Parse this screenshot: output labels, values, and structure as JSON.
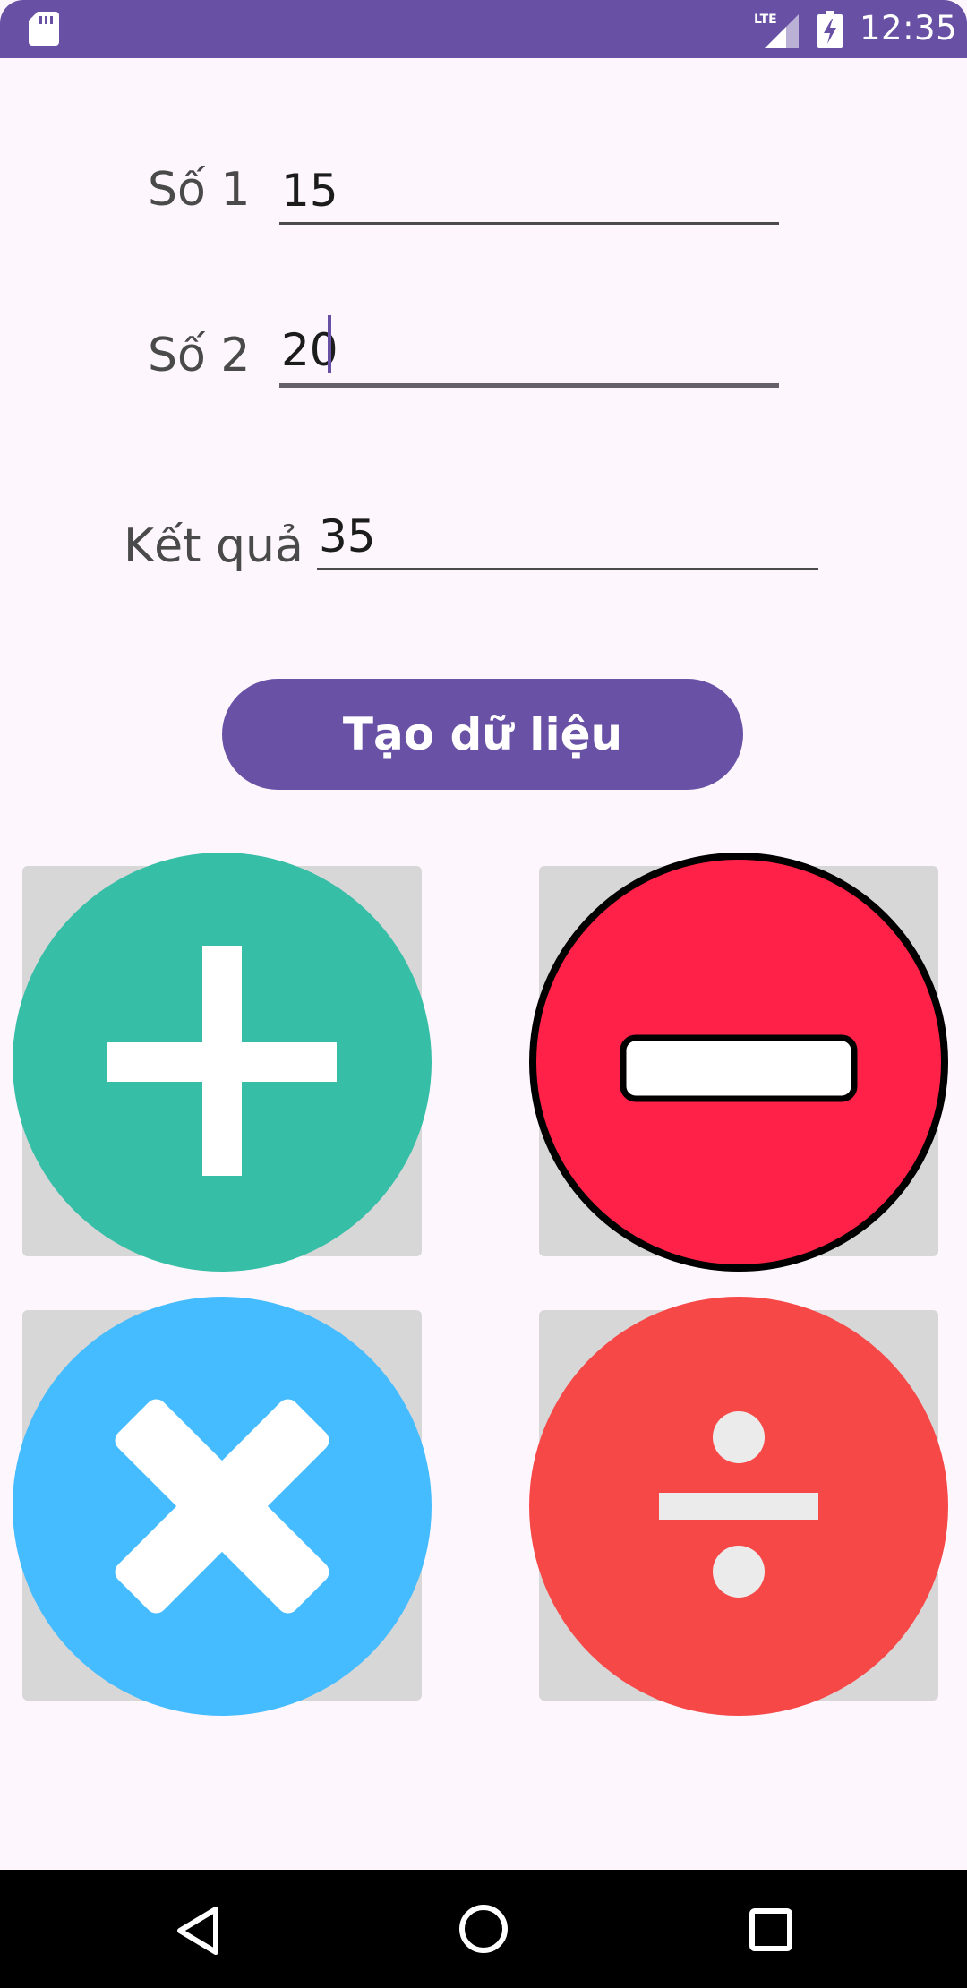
{
  "status_bar": {
    "time": "12:35",
    "network": "LTE",
    "icons": [
      "sd-card-icon",
      "signal-icon",
      "battery-charging-icon"
    ]
  },
  "form": {
    "number1": {
      "label": "Số 1",
      "value": "15"
    },
    "number2": {
      "label": "Số 2",
      "value": "20"
    },
    "result": {
      "label": "Kết quả",
      "value": "35"
    }
  },
  "generate_button": {
    "label": "Tạo dữ liệu"
  },
  "operations": [
    {
      "name": "add",
      "icon": "plus-icon",
      "color": "#36bea7"
    },
    {
      "name": "subtract",
      "icon": "minus-icon",
      "color": "#ff2147"
    },
    {
      "name": "multiply",
      "icon": "multiply-icon",
      "color": "#45bcff"
    },
    {
      "name": "divide",
      "icon": "divide-icon",
      "color": "#f74848"
    }
  ],
  "nav_bar": {
    "icons": [
      "back-icon",
      "home-icon",
      "recents-icon"
    ]
  },
  "colors": {
    "primary": "#6851a5",
    "background": "#fdf7fd"
  }
}
